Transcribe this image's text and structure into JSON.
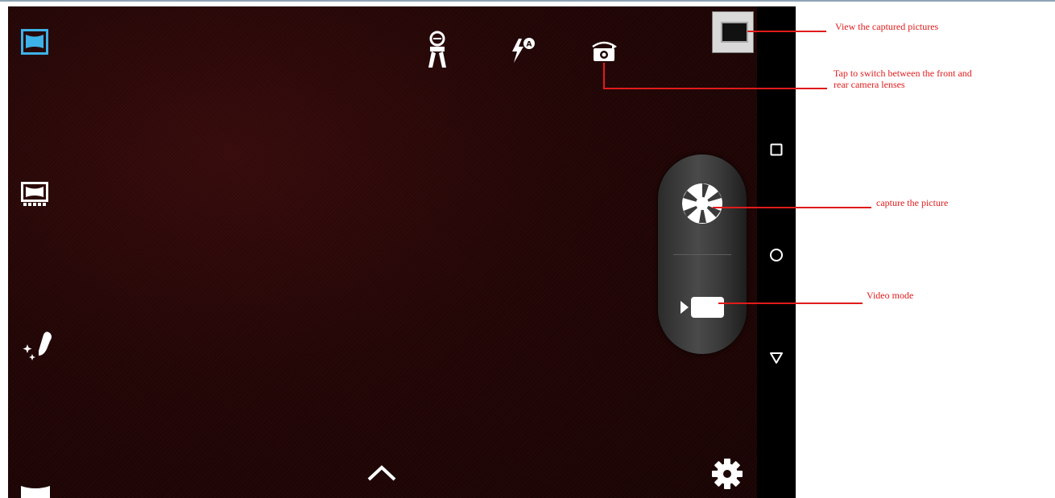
{
  "annotations": {
    "gallery": "View the captured pictures",
    "switch_camera_line1": "Tap to switch between the front and",
    "switch_camera_line2": "rear camera lenses",
    "capture": "capture the picture",
    "video": "Video mode"
  },
  "colors": {
    "viewfinder": "#240707",
    "annotation": "#e11b1b",
    "active_mode": "#3db2e8",
    "navbar": "#000000"
  },
  "icons": {
    "left_modes": [
      "panorama-icon",
      "photo-sphere-icon",
      "effects-icon",
      "portrait-icon"
    ],
    "top_bar": [
      "hdr-icon",
      "flash-auto-icon",
      "switch-camera-icon"
    ],
    "shutter": [
      "shutter-icon",
      "video-camera-icon"
    ],
    "navbar": [
      "recent-apps-icon",
      "home-icon",
      "back-icon"
    ],
    "bottom": [
      "chevron-up-icon",
      "settings-gear-icon"
    ]
  }
}
